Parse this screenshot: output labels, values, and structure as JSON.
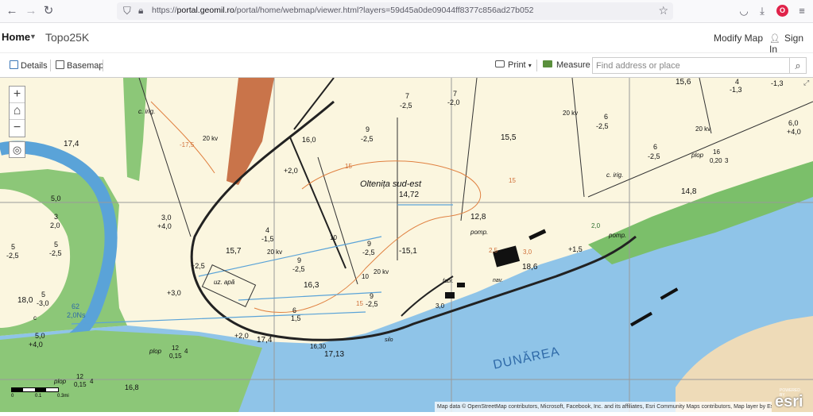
{
  "browser": {
    "back_icon": "arrow-left-icon",
    "url_host": "portal.geomil.ro",
    "url_prefix": "https://",
    "url_path": "/portal/home/webmap/viewer.html?layers=59d45a0de09044ff8377c856ad27b052"
  },
  "header": {
    "home_label": "Home",
    "map_title": "Topo25K",
    "modify_label": "Modify Map",
    "signin_label": "Sign In"
  },
  "toolbar": {
    "details_label": "Details",
    "basemap_label": "Basemap",
    "print_label": "Print",
    "measure_label": "Measure",
    "search_placeholder": "Find address or place"
  },
  "map": {
    "zoom_in": "+",
    "zoom_out": "−",
    "home_icon": "home-icon",
    "locate_icon": "locate-icon",
    "attribution": "Map data © OpenStreetMap contributors, Microsoft, Facebook, Inc. and its affiliates, Esri Community Maps contributors, Map layer by Esri",
    "esri_logo": "esri",
    "esri_powered": "POWERED BY",
    "scale_labels": [
      "0",
      "0.1",
      "0.3mi"
    ],
    "labels": [
      {
        "t": "17,4"
      },
      {
        "t": "c. irig."
      },
      {
        "t": "20 kv"
      },
      {
        "t": "-17,5"
      },
      {
        "t": "16,0"
      },
      {
        "t": "+2,0"
      },
      {
        "t": "7"
      },
      {
        "t": "-2,5"
      },
      {
        "t": "7"
      },
      {
        "t": "-2,0"
      },
      {
        "t": "20 kv"
      },
      {
        "t": "6"
      },
      {
        "t": "-2,5"
      },
      {
        "t": "15,6"
      },
      {
        "t": "4"
      },
      {
        "t": "-1,3"
      },
      {
        "t": "-1,3"
      },
      {
        "t": "20 kv"
      },
      {
        "t": "6,0"
      },
      {
        "t": "+4,0"
      },
      {
        "t": "9"
      },
      {
        "t": "-2,5"
      },
      {
        "t": "15,5"
      },
      {
        "t": "6"
      },
      {
        "t": "-2,5"
      },
      {
        "t": "plop"
      },
      {
        "t": "16"
      },
      {
        "t": "0,20"
      },
      {
        "t": "3"
      },
      {
        "t": "c. irig."
      },
      {
        "t": "Oltenița sud-est"
      },
      {
        "t": "14,72"
      },
      {
        "t": "15"
      },
      {
        "t": "15"
      },
      {
        "t": "14,8"
      },
      {
        "t": "3,0"
      },
      {
        "t": "+4,0"
      },
      {
        "t": "-1,5"
      },
      {
        "t": "4"
      },
      {
        "t": "20 kv"
      },
      {
        "t": "15,7"
      },
      {
        "t": "10"
      },
      {
        "t": "9"
      },
      {
        "t": "-2,5"
      },
      {
        "t": "-15,1"
      },
      {
        "t": "12,8"
      },
      {
        "t": "pomp."
      },
      {
        "t": "pomp."
      },
      {
        "t": "+1,5"
      },
      {
        "t": "3,0"
      },
      {
        "t": "2,0"
      },
      {
        "t": "+2,5"
      },
      {
        "t": "9"
      },
      {
        "t": "-2,5"
      },
      {
        "t": "20 kv"
      },
      {
        "t": "10"
      },
      {
        "t": "2,5"
      },
      {
        "t": "18,6"
      },
      {
        "t": "uz. apă"
      },
      {
        "t": "16,3"
      },
      {
        "t": "fabr."
      },
      {
        "t": "nav."
      },
      {
        "t": "+3,0"
      },
      {
        "t": "6"
      },
      {
        "t": "1,5"
      },
      {
        "t": "15"
      },
      {
        "t": "9"
      },
      {
        "t": "-2,5"
      },
      {
        "t": "3,0"
      },
      {
        "t": "+2,0"
      },
      {
        "t": "17,4"
      },
      {
        "t": "16,30"
      },
      {
        "t": "17,13"
      },
      {
        "t": "silo"
      },
      {
        "t": "plop"
      },
      {
        "t": "12"
      },
      {
        "t": "0,15"
      },
      {
        "t": "4"
      },
      {
        "t": "plop"
      },
      {
        "t": "12"
      },
      {
        "t": "0,15"
      },
      {
        "t": "4"
      },
      {
        "t": "16,8"
      },
      {
        "t": "DUNĂREA"
      },
      {
        "t": "18,0"
      },
      {
        "t": "5"
      },
      {
        "t": "-3,0"
      },
      {
        "t": "5,0"
      },
      {
        "t": "+4,0"
      },
      {
        "t": "62"
      },
      {
        "t": "2,0Ns"
      },
      {
        "t": "3"
      },
      {
        "t": "2,0"
      },
      {
        "t": "5"
      },
      {
        "t": "-2,5"
      },
      {
        "t": "5"
      },
      {
        "t": "-2,5"
      },
      {
        "t": "c"
      },
      {
        "t": "5,0"
      }
    ]
  }
}
